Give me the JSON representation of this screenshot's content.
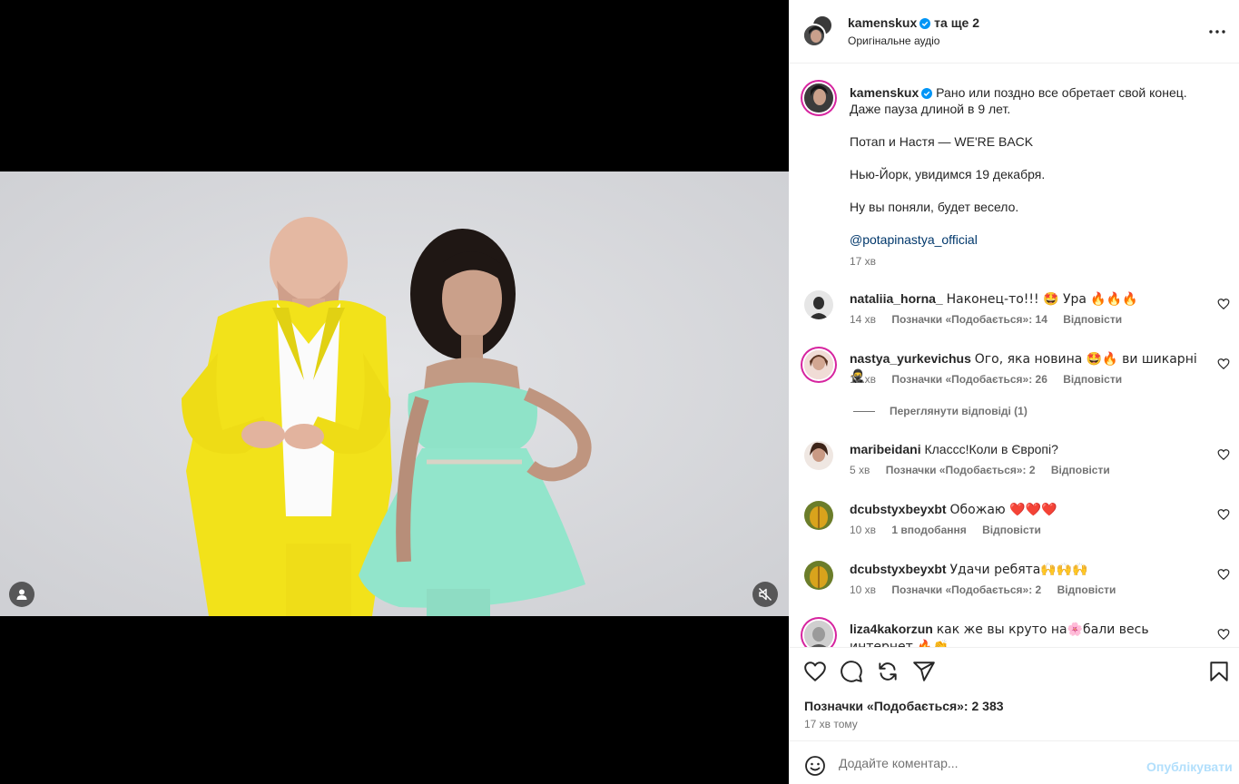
{
  "header": {
    "username": "kamenskux",
    "coauthors": "та ще 2",
    "audio": "Оригінальне аудіо"
  },
  "caption": {
    "username": "kamenskux",
    "lines": [
      "Рано или поздно все обретает свой конец.",
      "Даже пауза длиной в 9 лет.",
      "",
      "Потап и Настя — WE'RE BACK",
      "",
      "Нью-Йорк, увидимся 19 декабря.",
      "",
      "Ну вы поняли, будет весело.",
      ""
    ],
    "mention": "@potapinastya_official",
    "time": "17 хв"
  },
  "comments": [
    {
      "username": "nataliia_horna_",
      "text": "Наконец-то!!! 🤩 Ура 🔥🔥🔥",
      "time": "14 хв",
      "likes": "Позначки «Подобається»: 14",
      "reply": "Відповісти"
    },
    {
      "username": "nastya_yurkevichus",
      "text": "Ого, яка новина 🤩🔥 ви шикарні 🥷",
      "time": "12 хв",
      "likes": "Позначки «Подобається»: 26",
      "reply": "Відповісти"
    },
    {
      "username": "maribeidani",
      "text": "Классс!Коли в Європі?",
      "time": "5 хв",
      "likes": "Позначки «Подобається»: 2",
      "reply": "Відповісти"
    },
    {
      "username": "dcubstyxbeyxbt",
      "text": "Обожаю ❤️❤️❤️",
      "time": "10 хв",
      "likes": "1 вподобання",
      "reply": "Відповісти"
    },
    {
      "username": "dcubstyxbeyxbt",
      "text": "Удачи ребята🙌🙌🙌",
      "time": "10 хв",
      "likes": "Позначки «Подобається»: 2",
      "reply": "Відповісти"
    },
    {
      "username": "liza4kakorzun",
      "text": "как же вы круто на🌸бали весь интернет 🔥👏",
      "time": "",
      "likes": "",
      "reply": ""
    }
  ],
  "view_replies": "Переглянути відповіді (1)",
  "actions": {
    "likes": "Позначки «Подобається»: 2 383",
    "time": "17 хв тому"
  },
  "composer": {
    "placeholder": "Додайте коментар...",
    "publish": "Опублікувати"
  },
  "icons": {
    "verified": "verified-badge-icon",
    "more": "more-options-icon",
    "like": "heart-icon",
    "comment": "comment-icon",
    "repost": "repost-icon",
    "share": "share-icon",
    "save": "bookmark-icon",
    "emoji": "emoji-icon",
    "mute": "speaker-muted-icon",
    "tags": "user-tag-icon"
  },
  "colors": {
    "verified": "#0095f6",
    "link": "#00376b",
    "publish_disabled": "#b2dffc",
    "suit": "#f2e21a",
    "dress": "#8fe3c8"
  }
}
